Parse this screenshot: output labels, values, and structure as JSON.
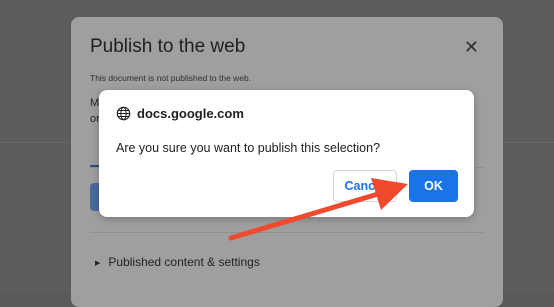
{
  "background_dialog": {
    "title": "Publish to the web",
    "notice": "This document is not published to the web.",
    "link_tab_partial_line1": "M",
    "link_tab_partial_line2": "or",
    "published_section": "Published content & settings"
  },
  "confirm_dialog": {
    "origin": "docs.google.com",
    "question": "Are you sure you want to publish this selection?",
    "cancel_label": "Cancel",
    "ok_label": "OK"
  },
  "colors": {
    "accent": "#1a73e8",
    "annotation_arrow": "#f04a2e"
  }
}
